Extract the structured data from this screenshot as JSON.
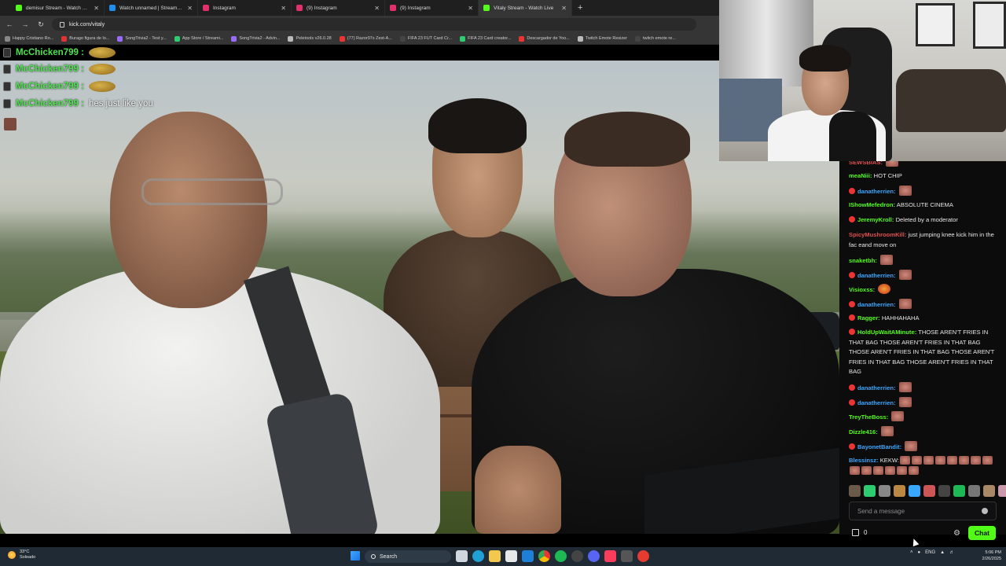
{
  "tabs": [
    {
      "title": "demisur Stream - Watch Live o",
      "color": "#53fc18",
      "active": false
    },
    {
      "title": "Watch unnamed | Streamable",
      "color": "#1f8ef1",
      "active": false
    },
    {
      "title": "Instagram",
      "color": "#e1306c",
      "active": false
    },
    {
      "title": "(9) Instagram",
      "color": "#e1306c",
      "active": false
    },
    {
      "title": "(9) Instagram",
      "color": "#e1306c",
      "active": false
    },
    {
      "title": "Vitaly Stream - Watch Live",
      "color": "#53fc18",
      "active": true
    }
  ],
  "address": {
    "url": "kick.com/vitaly"
  },
  "bookmarks": [
    {
      "label": "Happy Cristiano Ro...",
      "color": "#888"
    },
    {
      "label": "Burago figura de lo...",
      "color": "#d33"
    },
    {
      "label": "SongTrivia2 - Test y...",
      "color": "#9a6bff"
    },
    {
      "label": "App Store / Streami...",
      "color": "#2ecc71"
    },
    {
      "label": "SongTrivia2 - Advin...",
      "color": "#9a6bff"
    },
    {
      "label": "Peletools v26.0.28",
      "color": "#bbb"
    },
    {
      "label": "(77) Razor97s Zest-A...",
      "color": "#e33"
    },
    {
      "label": "FIFA 23 FUT Card Cr...",
      "color": "#444"
    },
    {
      "label": "FIFA 23 Card creator...",
      "color": "#2ecc71"
    },
    {
      "label": "Descargador de Yoo...",
      "color": "#e33"
    },
    {
      "label": "Twitch Emote Resizer",
      "color": "#bbb"
    },
    {
      "label": "twitch emote re...",
      "color": "#444"
    }
  ],
  "overlay_chat": [
    {
      "name": "McChicken799 :",
      "message": "",
      "emote": true
    },
    {
      "name": "McChicken799 :",
      "message": "",
      "emote": true
    },
    {
      "name": "McChicken799 :",
      "message": "",
      "emote": true
    },
    {
      "name": "McChicken799 :",
      "message": "hes just like you",
      "emote": false
    }
  ],
  "chat": {
    "messages": [
      {
        "name": "SEWSBIAS:",
        "color": "#e05050",
        "text": "",
        "emotes": 1,
        "badge": false
      },
      {
        "name": "meaNiii:",
        "color": "#53fc18",
        "text": "HOT CHIP",
        "emotes": 0,
        "badge": false
      },
      {
        "name": "danatherrien:",
        "color": "#3aa7ff",
        "text": "",
        "emotes": 1,
        "badge": true
      },
      {
        "name": "IShowMefedron:",
        "color": "#53fc18",
        "text": "ABSOLUTE CINEMA",
        "emotes": 0,
        "badge": false
      },
      {
        "name": "JeremyKroll:",
        "color": "#53fc18",
        "text": "Deleted by a moderator",
        "emotes": 0,
        "badge": true
      },
      {
        "name": "SpicyMushroomKill:",
        "color": "#e05050",
        "text": "just jumping knee kick him in the fac eand move on",
        "emotes": 0,
        "badge": false
      },
      {
        "name": "snaketbh:",
        "color": "#53fc18",
        "text": "",
        "emotes": 1,
        "badge": false
      },
      {
        "name": "danatherrien:",
        "color": "#3aa7ff",
        "text": "",
        "emotes": 1,
        "badge": true
      },
      {
        "name": "Visioxss:",
        "color": "#53fc18",
        "text": "",
        "emotes": 1,
        "badge": false
      },
      {
        "name": "danatherrien:",
        "color": "#3aa7ff",
        "text": "",
        "emotes": 1,
        "badge": true
      },
      {
        "name": "Ragger:",
        "color": "#53fc18",
        "text": "HAHHAHAHA",
        "emotes": 0,
        "badge": true
      },
      {
        "name": "HoldUpWaitAMinute:",
        "color": "#53fc18",
        "text": "THOSE AREN'T FRIES IN THAT BAG THOSE AREN'T FRIES IN THAT BAG THOSE AREN'T FRIES IN THAT BAG THOSE AREN'T FRIES IN THAT BAG THOSE AREN'T FRIES IN THAT BAG",
        "emotes": 0,
        "badge": true
      },
      {
        "name": "danatherrien:",
        "color": "#3aa7ff",
        "text": "",
        "emotes": 1,
        "badge": true
      },
      {
        "name": "danatherrien:",
        "color": "#3aa7ff",
        "text": "",
        "emotes": 1,
        "badge": true
      },
      {
        "name": "TreyTheBoss:",
        "color": "#53fc18",
        "text": "",
        "emotes": 1,
        "badge": false
      },
      {
        "name": "Dizzle416:",
        "color": "#53fc18",
        "text": "",
        "emotes": 1,
        "badge": false
      },
      {
        "name": "BayonetBandit:",
        "color": "#3aa7ff",
        "text": "",
        "emotes": 1,
        "badge": true
      },
      {
        "name": "Blessinsz:",
        "color": "#3aa7ff",
        "text": "KEKW:",
        "emotes": 14,
        "badge": false
      }
    ],
    "input_placeholder": "Send a message",
    "points": "0",
    "send_label": "Chat"
  },
  "taskbar": {
    "weather_temp": "33°C",
    "weather_desc": "Soleado",
    "search_label": "Search",
    "lang": "ENG",
    "time": "5:06 PM",
    "date": "2/26/2025"
  }
}
